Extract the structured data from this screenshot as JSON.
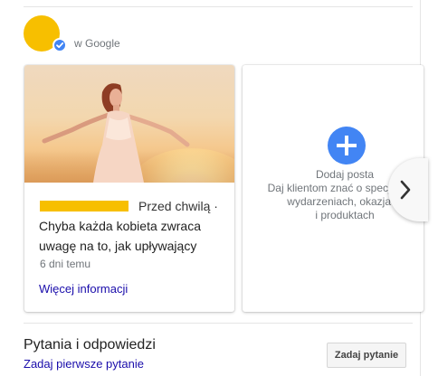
{
  "header": {
    "in_google": "w Google"
  },
  "post": {
    "time": "Przed chwilą ·",
    "text": "Chyba każda kobieta zwraca uwagę na to, jak upływający",
    "age": "6 dni temu",
    "more_label": "Więcej informacji"
  },
  "add_post": {
    "title": "Dodaj posta",
    "line1": "Daj klientom znać o specjalnych",
    "line2": "wydarzeniach, okazjach",
    "line3": "i produktach"
  },
  "qa": {
    "title": "Pytania i odpowiedzi",
    "link": "Zadaj pierwsze pytanie",
    "ask_button": "Zadaj pytanie"
  },
  "colors": {
    "accent": "#4285f4",
    "brand_yellow": "#f7bf00",
    "link": "#1a0dab"
  },
  "icons": [
    "verified-badge-icon",
    "plus-icon",
    "chevron-right-icon"
  ]
}
